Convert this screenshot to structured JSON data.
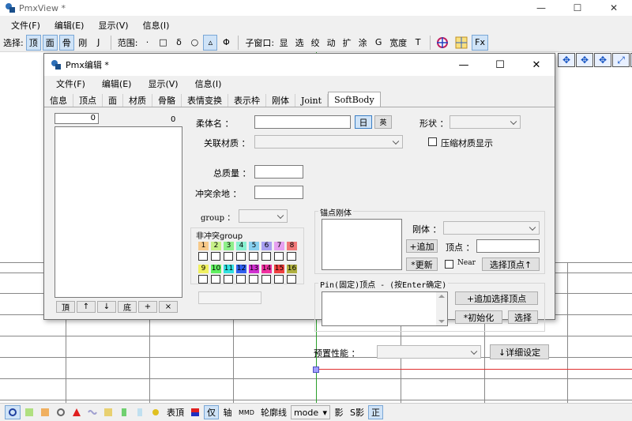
{
  "main_window": {
    "title": "PmxView *",
    "menu": [
      "文件(F)",
      "编辑(E)",
      "显示(V)",
      "信息(I)"
    ],
    "controls": {
      "minimize": "—",
      "maximize": "☐",
      "close": "✕"
    }
  },
  "toolbar": {
    "select_label": "选择:",
    "select_items": [
      "顶",
      "面",
      "骨",
      "刚",
      "J"
    ],
    "range_label": "范围:",
    "range_items": [
      "·",
      "□",
      "δ",
      "○",
      "▵",
      "Φ"
    ],
    "subwindow_label": "子窗口:",
    "subwindow_items": [
      "显",
      "选",
      "绞",
      "动",
      "扩",
      "涂",
      "G",
      "宽度",
      "T"
    ],
    "fx": "Fx"
  },
  "right_tools": [
    "✥",
    "✥",
    "✥",
    "⤢",
    "↻"
  ],
  "bottom_bar": {
    "items": [
      "表頂",
      "仅",
      "轴",
      "MMD",
      "轮廓线",
      "mode",
      "影",
      "S影",
      "正"
    ]
  },
  "dialog": {
    "title": "Pmx编辑 *",
    "menu": [
      "文件(F)",
      "编辑(E)",
      "显示(V)",
      "信息(I)"
    ],
    "controls": {
      "minimize": "—",
      "maximize": "☐",
      "close": "✕"
    },
    "tabs": [
      "信息",
      "顶点",
      "面",
      "材质",
      "骨骼",
      "表情变换",
      "表示枠",
      "刚体",
      "Joint",
      "SoftBody"
    ],
    "active_tab": "SoftBody",
    "list": {
      "index_value": "0",
      "count": "0",
      "buttons": [
        "頂",
        "↑",
        "↓",
        "底",
        "+",
        "×"
      ]
    },
    "form": {
      "name_label": "柔体名 ：",
      "lang_jp": "日",
      "lang_en": "英",
      "shape_label": "形状 ：",
      "material_label": "关联材质 ：",
      "compress_label": "压缩材质显示",
      "mass_label": "总质量 ：",
      "margin_label": "冲突余地 ：",
      "group_label": "group ：",
      "non_collision_title": "非冲突group",
      "non_collision_row1": [
        "1",
        "2",
        "3",
        "4",
        "5",
        "6",
        "7",
        "8"
      ],
      "non_collision_row2": [
        "9",
        "10",
        "11",
        "12",
        "13",
        "14",
        "15",
        "16"
      ],
      "anchor_title": "锚点刚体",
      "rigid_label": "刚体 ：",
      "add_button": "+追加",
      "vertex_label": "顶点 ：",
      "update_button": "*更新",
      "near_label": "Near",
      "select_vertex_button": "选择顶点↑",
      "pin_title": "Pin(固定)顶点 - (按Enter确定)",
      "add_selected_vertex_button": "+追加选择顶点",
      "init_button": "*初始化",
      "select_button": "选择",
      "preset_label": "预置性能 ：",
      "detail_button": "↓详细设定"
    },
    "group_colors": [
      "#f7c98a",
      "#c7f088",
      "#8ff08a",
      "#88f0d0",
      "#88d0f0",
      "#a8a0f0",
      "#e6a0f0",
      "#f07878",
      "#f0f060",
      "#60f060",
      "#30e0e0",
      "#3060f0",
      "#d030d0",
      "#f030a0",
      "#f04040",
      "#b0b040"
    ]
  }
}
